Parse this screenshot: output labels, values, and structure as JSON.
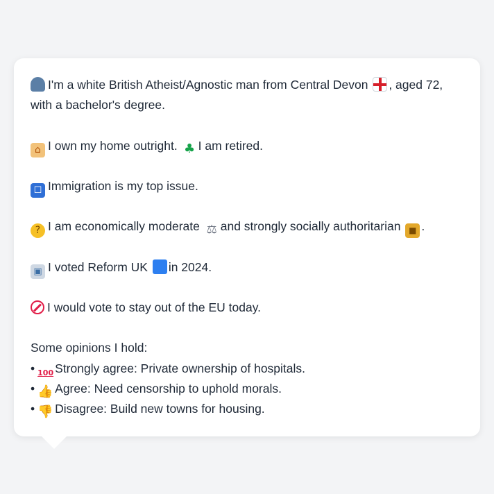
{
  "profile": {
    "intro_part1": "I'm a white British Atheist/Agnostic man from Central Devon",
    "intro_part2": ", aged 72,",
    "intro_line2": "with a bachelor's degree.",
    "home_text": "I own my home outright.",
    "retired_text": "I am retired.",
    "issue_text": "Immigration is my top issue.",
    "econ_text_a": "I am economically moderate",
    "econ_text_b": "and strongly socially authoritarian",
    "econ_text_c": ".",
    "vote_text_a": "I voted Reform UK",
    "vote_text_b": "in 2024.",
    "eu_text": "I would vote to stay out of the EU today.",
    "opinions_heading": "Some opinions I hold:",
    "opinions": [
      {
        "bullet": "•",
        "icon": "hundred-points-icon",
        "text": "Strongly agree: Private ownership of hospitals."
      },
      {
        "bullet": "•",
        "icon": "thumbs-up-icon",
        "text": "Agree: Need censorship to uphold morals."
      },
      {
        "bullet": "•",
        "icon": "thumbs-down-icon",
        "text": "Disagree: Build new towns for housing."
      }
    ]
  },
  "icons": {
    "person": "person-silhouette-icon",
    "flag": "england-flag-icon",
    "house": "house-icon",
    "palm": "palm-tree-icon",
    "passport": "passport-control-icon",
    "thinking": "thinking-face-icon",
    "scales": "balance-scale-icon",
    "lock": "padlock-icon",
    "ballot": "ballot-box-icon",
    "blue_square": "blue-square-icon",
    "no_entry": "prohibited-icon"
  },
  "colors": {
    "background": "#f3f4f6",
    "card": "#ffffff",
    "text": "#1f2937"
  }
}
